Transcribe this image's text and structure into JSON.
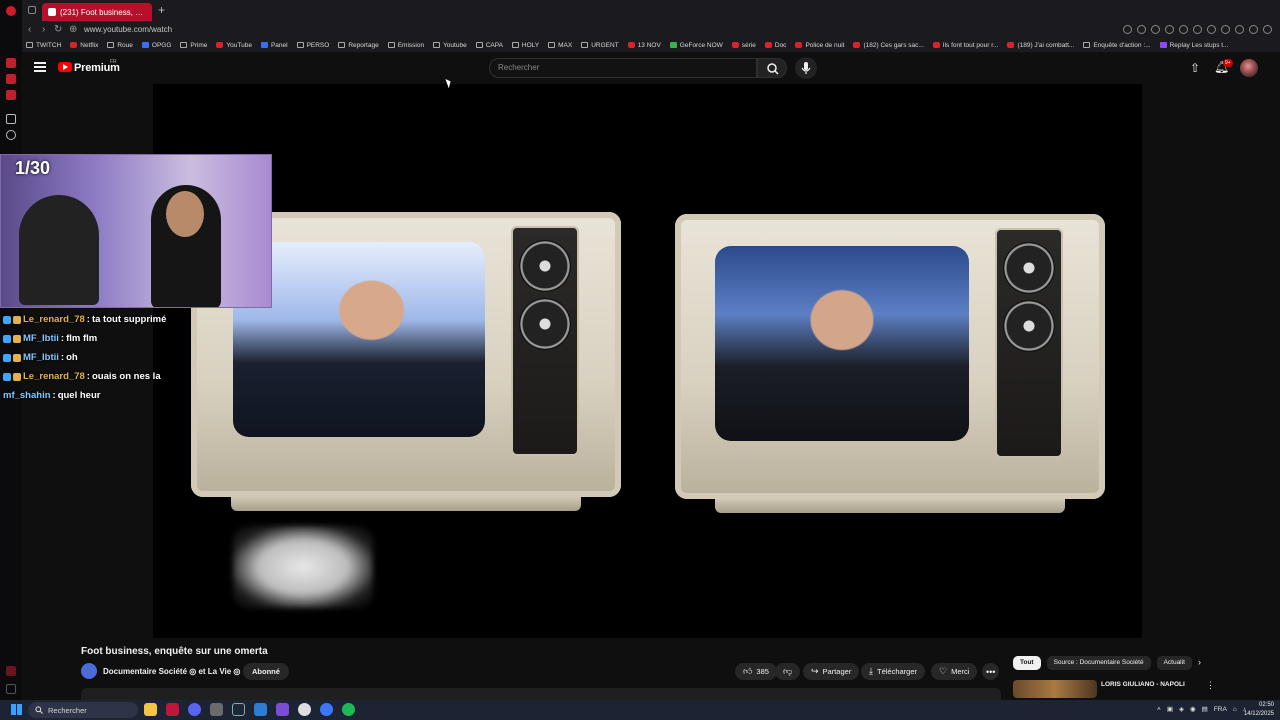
{
  "browser": {
    "tab_title": "(231) Foot business, enq...",
    "url": "www.youtube.com/watch",
    "bookmarks": [
      {
        "label": "TWITCH",
        "icon": "folder-icon",
        "color": ""
      },
      {
        "label": "Netflix",
        "icon": "netflix-icon",
        "color": "red"
      },
      {
        "label": "Roue",
        "icon": "roue-icon",
        "color": ""
      },
      {
        "label": "OPGG",
        "icon": "opgg-icon",
        "color": "blu"
      },
      {
        "label": "Prime",
        "icon": "page-icon",
        "color": ""
      },
      {
        "label": "YouTube",
        "icon": "youtube-icon",
        "color": "red"
      },
      {
        "label": "Panel",
        "icon": "panel-icon",
        "color": "blu"
      },
      {
        "label": "PERSO",
        "icon": "folder-icon",
        "color": ""
      },
      {
        "label": "Reportage",
        "icon": "folder-icon",
        "color": ""
      },
      {
        "label": "Emission",
        "icon": "folder-icon",
        "color": ""
      },
      {
        "label": "Youtube",
        "icon": "folder-icon",
        "color": ""
      },
      {
        "label": "CAPA",
        "icon": "page-icon",
        "color": ""
      },
      {
        "label": "HOLY",
        "icon": "folder-icon",
        "color": ""
      },
      {
        "label": "MAX",
        "icon": "folder-icon",
        "color": ""
      },
      {
        "label": "URGENT",
        "icon": "folder-icon",
        "color": ""
      },
      {
        "label": "13 NOV",
        "icon": "youtube-icon",
        "color": "red"
      },
      {
        "label": "GeForce NOW",
        "icon": "geforce-icon",
        "color": "grn"
      },
      {
        "label": "série",
        "icon": "youtube-icon",
        "color": "red"
      },
      {
        "label": "Doc",
        "icon": "youtube-icon",
        "color": "red"
      },
      {
        "label": "Police de nuit",
        "icon": "youtube-icon",
        "color": "red"
      },
      {
        "label": "(182) Ces gars sac...",
        "icon": "youtube-icon",
        "color": "red"
      },
      {
        "label": "Ils font tout pour r...",
        "icon": "youtube-icon",
        "color": "red"
      },
      {
        "label": "(189) J'ai combatt...",
        "icon": "youtube-icon",
        "color": "red"
      },
      {
        "label": "Enquête d'action :...",
        "icon": "page-icon",
        "color": ""
      },
      {
        "label": "Replay Les stups t...",
        "icon": "replay-icon",
        "color": "pur"
      }
    ]
  },
  "youtube": {
    "brand": "Premium",
    "region": "FR",
    "search_placeholder": "Rechercher",
    "notification_count": "9+",
    "video_title": "Foot business, enquête sur une omerta",
    "channel_name": "Documentaire Société ◎ et La Vie ◎",
    "subscribed_label": "Abonné",
    "likes": "385",
    "share_label": "Partager",
    "download_label": "Télécharger",
    "thanks_label": "Merci",
    "chips": [
      {
        "label": "Tout",
        "active": true
      },
      {
        "label": "Source : Documentaire Société",
        "active": false
      },
      {
        "label": "Actualit",
        "active": false
      }
    ],
    "rec_title": "LORIS GIULIANO - NAPOLI"
  },
  "stream": {
    "counter": "1/30",
    "chat": [
      {
        "user": "Le_renard_78",
        "message": "ta tout supprimé",
        "user_color": "#e3b24e",
        "badges": [
          "#3ea6ff",
          "#e3b24e"
        ]
      },
      {
        "user": "MF_Ibtii",
        "message": "flm flm",
        "user_color": "#7ec8ff",
        "badges": [
          "#3ea6ff",
          "#e3b24e"
        ]
      },
      {
        "user": "MF_Ibtii",
        "message": "oh",
        "user_color": "#7ec8ff",
        "badges": [
          "#3ea6ff",
          "#e3b24e"
        ]
      },
      {
        "user": "Le_renard_78",
        "message": "ouais on nes la",
        "user_color": "#e3b24e",
        "badges": [
          "#3ea6ff",
          "#e3b24e"
        ]
      },
      {
        "user": "mf_shahin",
        "message": "quel heur",
        "user_color": "#7ec8ff",
        "badges": []
      }
    ]
  },
  "taskbar": {
    "search_label": "Rechercher",
    "lang": "FRA",
    "time": "02:50",
    "date": "14/12/2025"
  },
  "colors": {
    "youtube_red": "#ff0000",
    "tab_active": "#b7102a",
    "chat_user_gold": "#e3b24e"
  }
}
